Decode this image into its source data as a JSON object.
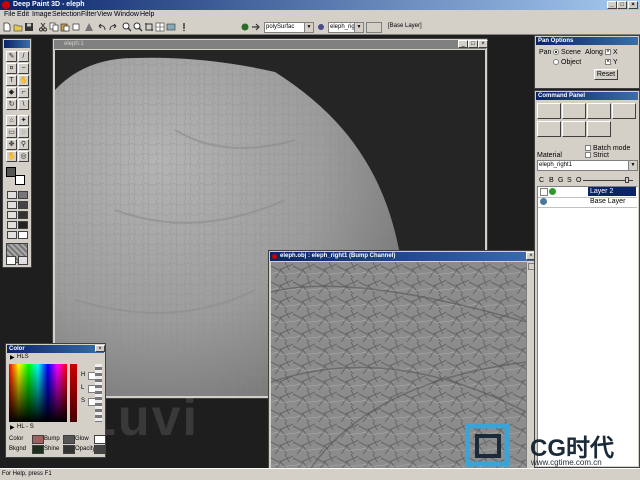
{
  "app": {
    "title": "Deep Paint 3D - eleph",
    "status": "For Help, press F1"
  },
  "menu": [
    "File",
    "Edit",
    "Image",
    "Selection",
    "Filter",
    "View",
    "Window",
    "Help"
  ],
  "toolbar": {
    "surface_combo": "polySurfac",
    "object_combo": "eleph_righ",
    "layer_field": "[Base Layer]"
  },
  "main_window": {
    "title": "eleph:1"
  },
  "bump_window": {
    "title": "eleph.obj : eleph_right1 (Bump Channel)"
  },
  "color_window": {
    "title": "Color",
    "mode": "HLS",
    "channels": [
      "H",
      "L",
      "S"
    ],
    "picker_mode": "HL - S",
    "rows": [
      {
        "label": "Color",
        "a": "Bump",
        "b": "Glow"
      },
      {
        "label": "Bkgnd",
        "a": "Shine",
        "b": "Opacity"
      }
    ]
  },
  "pan_options": {
    "title": "Pan Options",
    "pan_label": "Pan",
    "scene_label": "Scene",
    "object_label": "Object",
    "along_label": "Along",
    "x_label": "X",
    "y_label": "Y",
    "reset_label": "Reset"
  },
  "command_panel": {
    "title": "Command Panel",
    "material_label": "Material",
    "batch_label": "Batch mode",
    "strict_label": "Strict",
    "material_value": "eleph_right1",
    "columns": [
      "C",
      "B",
      "G",
      "S",
      "O"
    ],
    "layers": [
      {
        "name": "Layer 2",
        "selected": true
      },
      {
        "name": "Base Layer",
        "selected": false
      }
    ]
  },
  "watermark": {
    "brand": "CG时代",
    "url": "www.cgtime.com.cn"
  }
}
